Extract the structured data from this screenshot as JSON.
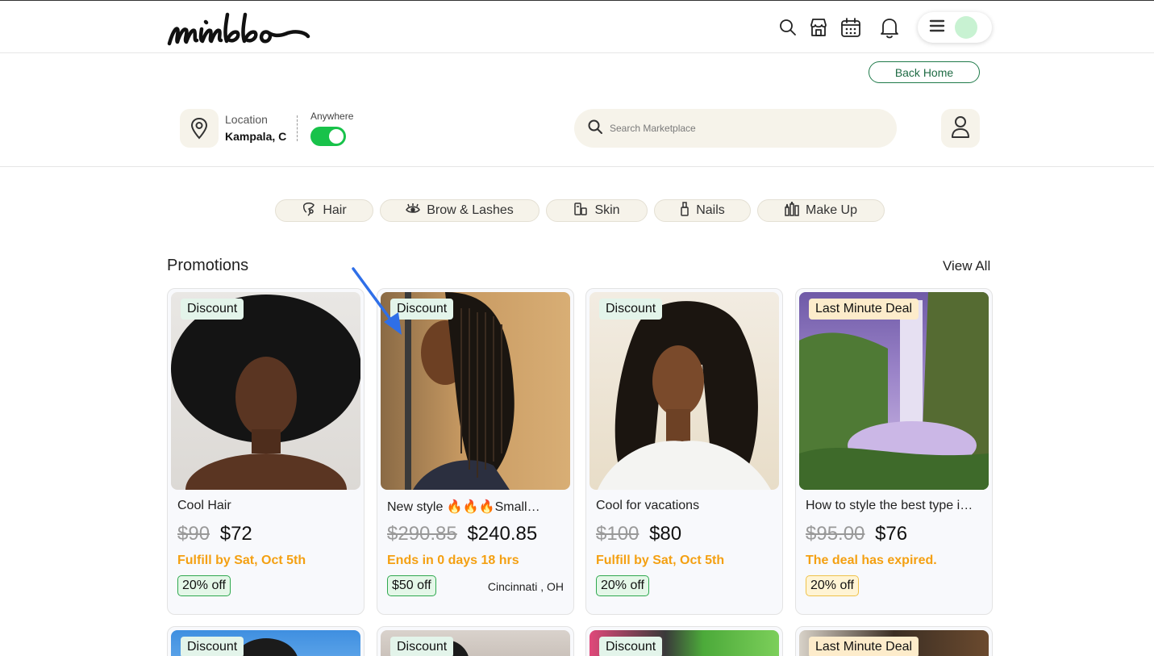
{
  "header": {
    "logo_text": "mimbbo",
    "icons": [
      "search-icon",
      "store-icon",
      "calendar-icon",
      "bell-icon",
      "menu-icon"
    ]
  },
  "back_home": "Back Home",
  "location": {
    "label": "Location",
    "value": "Kampala, C",
    "toggle_label": "Anywhere",
    "toggle_on": true
  },
  "search": {
    "placeholder": "Search Marketplace"
  },
  "categories": [
    {
      "label": "Hair",
      "icon": "hair-icon"
    },
    {
      "label": "Brow & Lashes",
      "icon": "eye-icon"
    },
    {
      "label": "Skin",
      "icon": "skin-icon"
    },
    {
      "label": "Nails",
      "icon": "nail-polish-icon"
    },
    {
      "label": "Make Up",
      "icon": "makeup-icon"
    }
  ],
  "promotions": {
    "title": "Promotions",
    "view_all": "View All",
    "cards": [
      {
        "badge": "Discount",
        "title": "Cool Hair",
        "old_price": "$90",
        "new_price": "$72",
        "status": "Fulfill by Sat, Oct 5th",
        "off": "20% off",
        "city": ""
      },
      {
        "badge": "Discount",
        "title": "New style 🔥🔥🔥Small…",
        "old_price": "$290.85",
        "new_price": "$240.85",
        "status": "Ends in 0 days 18 hrs",
        "off": "$50 off",
        "city": "Cincinnati , OH"
      },
      {
        "badge": "Discount",
        "title": "Cool for vacations",
        "old_price": "$100",
        "new_price": "$80",
        "status": "Fulfill by Sat, Oct 5th",
        "off": "20% off",
        "city": ""
      },
      {
        "badge": "Last Minute Deal",
        "title": "How to style the best type i…",
        "old_price": "$95.00",
        "new_price": "$76",
        "status": "The deal has expired.",
        "off": "20% off",
        "city": ""
      }
    ],
    "row2_badges": [
      "Discount",
      "Discount",
      "Discount",
      "Last Minute Deal"
    ]
  },
  "colors": {
    "accent_green": "#18c24a",
    "status_orange": "#f4a012",
    "badge_green_bg": "#e3f4ea",
    "badge_deal_bg": "#fdeccb",
    "annotation_arrow": "#2f6fe8"
  }
}
